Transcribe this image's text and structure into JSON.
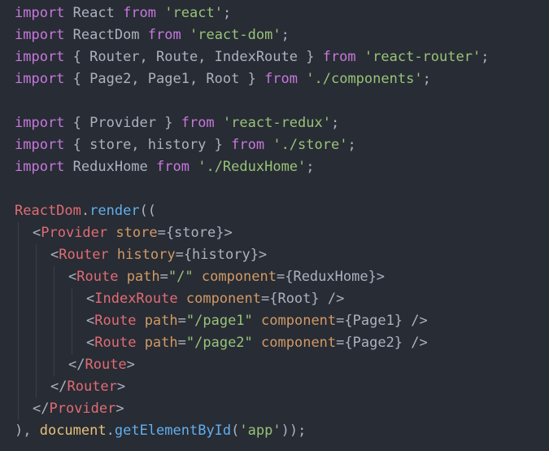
{
  "editor": {
    "colors": {
      "background": "#282c34",
      "text": "#abb2bf",
      "keyword": "#c678dd",
      "string": "#98c379",
      "tag": "#e06c75",
      "attribute": "#d19a66",
      "function": "#61afef",
      "object": "#e5c07b",
      "indent_guide": "#3b4048"
    },
    "lines": [
      {
        "indent": 0,
        "tokens": [
          {
            "t": "kw",
            "v": "import"
          },
          {
            "t": "plain",
            "v": " React "
          },
          {
            "t": "kw",
            "v": "from"
          },
          {
            "t": "plain",
            "v": " "
          },
          {
            "t": "str",
            "v": "'react'"
          },
          {
            "t": "plain",
            "v": ";"
          }
        ]
      },
      {
        "indent": 0,
        "tokens": [
          {
            "t": "kw",
            "v": "import"
          },
          {
            "t": "plain",
            "v": " ReactDom "
          },
          {
            "t": "kw",
            "v": "from"
          },
          {
            "t": "plain",
            "v": " "
          },
          {
            "t": "str",
            "v": "'react-dom'"
          },
          {
            "t": "plain",
            "v": ";"
          }
        ]
      },
      {
        "indent": 0,
        "tokens": [
          {
            "t": "kw",
            "v": "import"
          },
          {
            "t": "plain",
            "v": " { Router, Route, IndexRoute } "
          },
          {
            "t": "kw",
            "v": "from"
          },
          {
            "t": "plain",
            "v": " "
          },
          {
            "t": "str",
            "v": "'react-router'"
          },
          {
            "t": "plain",
            "v": ";"
          }
        ]
      },
      {
        "indent": 0,
        "tokens": [
          {
            "t": "kw",
            "v": "import"
          },
          {
            "t": "plain",
            "v": " { Page2, Page1, Root } "
          },
          {
            "t": "kw",
            "v": "from"
          },
          {
            "t": "plain",
            "v": " "
          },
          {
            "t": "str",
            "v": "'./components'"
          },
          {
            "t": "plain",
            "v": ";"
          }
        ]
      },
      {
        "indent": 0,
        "tokens": []
      },
      {
        "indent": 0,
        "tokens": [
          {
            "t": "kw",
            "v": "import"
          },
          {
            "t": "plain",
            "v": " { Provider } "
          },
          {
            "t": "kw",
            "v": "from"
          },
          {
            "t": "plain",
            "v": " "
          },
          {
            "t": "str",
            "v": "'react-redux'"
          },
          {
            "t": "plain",
            "v": ";"
          }
        ]
      },
      {
        "indent": 0,
        "tokens": [
          {
            "t": "kw",
            "v": "import"
          },
          {
            "t": "plain",
            "v": " { store, history } "
          },
          {
            "t": "kw",
            "v": "from"
          },
          {
            "t": "plain",
            "v": " "
          },
          {
            "t": "str",
            "v": "'./store'"
          },
          {
            "t": "plain",
            "v": ";"
          }
        ]
      },
      {
        "indent": 0,
        "tokens": [
          {
            "t": "kw",
            "v": "import"
          },
          {
            "t": "plain",
            "v": " ReduxHome "
          },
          {
            "t": "kw",
            "v": "from"
          },
          {
            "t": "plain",
            "v": " "
          },
          {
            "t": "str",
            "v": "'./ReduxHome'"
          },
          {
            "t": "plain",
            "v": ";"
          }
        ]
      },
      {
        "indent": 0,
        "tokens": []
      },
      {
        "indent": 0,
        "tokens": [
          {
            "t": "var",
            "v": "ReactDom"
          },
          {
            "t": "plain",
            "v": "."
          },
          {
            "t": "fn",
            "v": "render"
          },
          {
            "t": "plain",
            "v": "(("
          }
        ]
      },
      {
        "indent": 1,
        "tokens": [
          {
            "t": "plain",
            "v": "<"
          },
          {
            "t": "tag",
            "v": "Provider"
          },
          {
            "t": "plain",
            "v": " "
          },
          {
            "t": "attr",
            "v": "store"
          },
          {
            "t": "plain",
            "v": "={store}>"
          }
        ]
      },
      {
        "indent": 2,
        "tokens": [
          {
            "t": "plain",
            "v": "<"
          },
          {
            "t": "tag",
            "v": "Router"
          },
          {
            "t": "plain",
            "v": " "
          },
          {
            "t": "attr",
            "v": "history"
          },
          {
            "t": "plain",
            "v": "={history}>"
          }
        ]
      },
      {
        "indent": 3,
        "tokens": [
          {
            "t": "plain",
            "v": "<"
          },
          {
            "t": "tag",
            "v": "Route"
          },
          {
            "t": "plain",
            "v": " "
          },
          {
            "t": "attr",
            "v": "path"
          },
          {
            "t": "plain",
            "v": "="
          },
          {
            "t": "str",
            "v": "\"/\""
          },
          {
            "t": "plain",
            "v": " "
          },
          {
            "t": "attr",
            "v": "component"
          },
          {
            "t": "plain",
            "v": "={ReduxHome}>"
          }
        ]
      },
      {
        "indent": 4,
        "tokens": [
          {
            "t": "plain",
            "v": "<"
          },
          {
            "t": "tag",
            "v": "IndexRoute"
          },
          {
            "t": "plain",
            "v": " "
          },
          {
            "t": "attr",
            "v": "component"
          },
          {
            "t": "plain",
            "v": "={Root} />"
          }
        ]
      },
      {
        "indent": 4,
        "tokens": [
          {
            "t": "plain",
            "v": "<"
          },
          {
            "t": "tag",
            "v": "Route"
          },
          {
            "t": "plain",
            "v": " "
          },
          {
            "t": "attr",
            "v": "path"
          },
          {
            "t": "plain",
            "v": "="
          },
          {
            "t": "str",
            "v": "\"/page1\""
          },
          {
            "t": "plain",
            "v": " "
          },
          {
            "t": "attr",
            "v": "component"
          },
          {
            "t": "plain",
            "v": "={Page1} />"
          }
        ]
      },
      {
        "indent": 4,
        "tokens": [
          {
            "t": "plain",
            "v": "<"
          },
          {
            "t": "tag",
            "v": "Route"
          },
          {
            "t": "plain",
            "v": " "
          },
          {
            "t": "attr",
            "v": "path"
          },
          {
            "t": "plain",
            "v": "="
          },
          {
            "t": "str",
            "v": "\"/page2\""
          },
          {
            "t": "plain",
            "v": " "
          },
          {
            "t": "attr",
            "v": "component"
          },
          {
            "t": "plain",
            "v": "={Page2} />"
          }
        ]
      },
      {
        "indent": 3,
        "tokens": [
          {
            "t": "plain",
            "v": "</"
          },
          {
            "t": "tag",
            "v": "Route"
          },
          {
            "t": "plain",
            "v": ">"
          }
        ]
      },
      {
        "indent": 2,
        "tokens": [
          {
            "t": "plain",
            "v": "</"
          },
          {
            "t": "tag",
            "v": "Router"
          },
          {
            "t": "plain",
            "v": ">"
          }
        ]
      },
      {
        "indent": 1,
        "tokens": [
          {
            "t": "plain",
            "v": "</"
          },
          {
            "t": "tag",
            "v": "Provider"
          },
          {
            "t": "plain",
            "v": ">"
          }
        ]
      },
      {
        "indent": 0,
        "tokens": [
          {
            "t": "plain",
            "v": "), "
          },
          {
            "t": "obj",
            "v": "document"
          },
          {
            "t": "plain",
            "v": "."
          },
          {
            "t": "fn",
            "v": "getElementById"
          },
          {
            "t": "plain",
            "v": "("
          },
          {
            "t": "str",
            "v": "'app'"
          },
          {
            "t": "plain",
            "v": "));"
          }
        ]
      }
    ]
  }
}
